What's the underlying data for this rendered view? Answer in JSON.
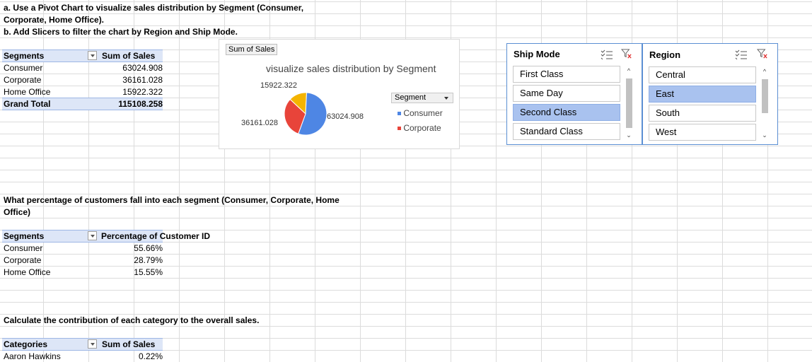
{
  "instructions": {
    "line1": "a. Use a Pivot Chart to visualize sales distribution by Segment (Consumer,",
    "line2": "Corporate, Home Office).",
    "line3": "b. Add Slicers to filter the chart by Region and Ship Mode."
  },
  "pivot1": {
    "header_row": "Segments",
    "header_value": "Sum of Sales",
    "rows": [
      {
        "label": "Consumer",
        "value": "63024.908"
      },
      {
        "label": "Corporate",
        "value": "36161.028"
      },
      {
        "label": "Home Office",
        "value": "15922.322"
      }
    ],
    "total_label": "Grand Total",
    "total_value": "115108.258"
  },
  "chart": {
    "field_button": "Sum of Sales",
    "title": "visualize sales distribution by Segment",
    "legend_title": "Segment",
    "legend_items": [
      {
        "label": "Consumer",
        "color": "#4e86e4"
      },
      {
        "label": "Corporate",
        "color": "#e8443a"
      }
    ],
    "data_labels": [
      "63024.908",
      "36161.028",
      "15922.322"
    ]
  },
  "chart_data": {
    "type": "pie",
    "title": "visualize sales distribution by Segment",
    "categories": [
      "Consumer",
      "Corporate",
      "Home Office"
    ],
    "values": [
      63024.908,
      36161.028,
      15922.322
    ],
    "colors": [
      "#4e86e4",
      "#e8443a",
      "#f4b400"
    ],
    "legend_position": "right"
  },
  "slicer_shipmode": {
    "title": "Ship Mode",
    "items": [
      {
        "label": "First Class",
        "selected": false
      },
      {
        "label": "Same Day",
        "selected": false
      },
      {
        "label": "Second Class",
        "selected": true
      },
      {
        "label": "Standard Class",
        "selected": false
      }
    ],
    "multiselect_icon": "multi-select-icon",
    "clear_icon": "clear-filter-icon"
  },
  "slicer_region": {
    "title": "Region",
    "items": [
      {
        "label": "Central",
        "selected": false
      },
      {
        "label": "East",
        "selected": true
      },
      {
        "label": "South",
        "selected": false
      },
      {
        "label": "West",
        "selected": false
      }
    ],
    "multiselect_icon": "multi-select-icon",
    "clear_icon": "clear-filter-icon"
  },
  "question2": {
    "line1": "What percentage of customers fall into each segment (Consumer, Corporate, Home",
    "line2": "Office)"
  },
  "pivot2": {
    "header_row": "Segments",
    "header_value": "Percentage of Customer ID",
    "rows": [
      {
        "label": "Consumer",
        "value": "55.66%"
      },
      {
        "label": "Corporate",
        "value": "28.79%"
      },
      {
        "label": "Home Office",
        "value": "15.55%"
      }
    ]
  },
  "question3": {
    "line1": "Calculate the contribution of each category to the overall sales."
  },
  "pivot3": {
    "header_row": "Categories",
    "header_value": "Sum of Sales",
    "rows": [
      {
        "label": "Aaron Hawkins",
        "value": "0.22%"
      }
    ]
  }
}
